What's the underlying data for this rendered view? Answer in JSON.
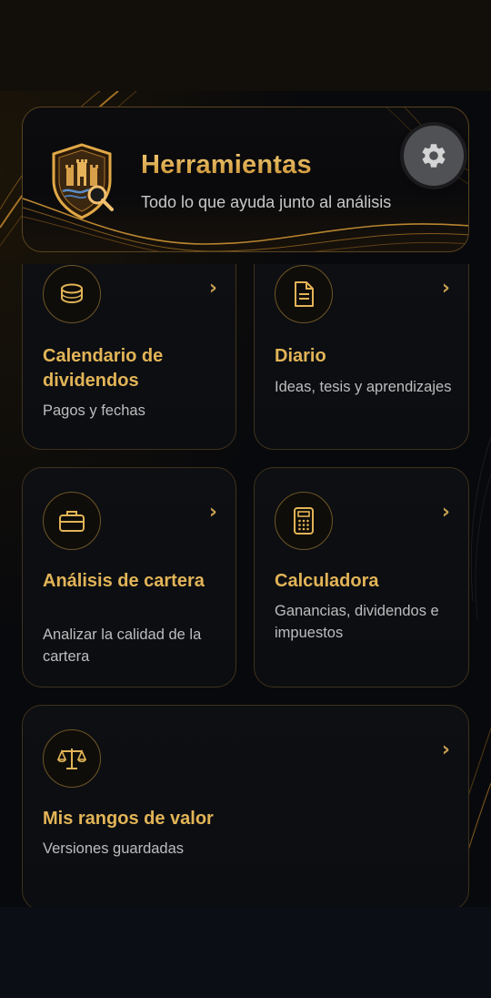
{
  "header": {
    "title": "Herramientas",
    "subtitle": "Todo lo que ayuda junto al análisis",
    "emblem_icon": "castle-shield-magnifier-icon",
    "settings_icon": "gear-icon"
  },
  "tools": [
    {
      "title": "Calendario de dividendos",
      "description": "Pagos y fechas",
      "icon": "coins-icon"
    },
    {
      "title": "Diario",
      "description": "Ideas, tesis y aprendizajes",
      "icon": "document-icon"
    },
    {
      "title": "Análisis de cartera",
      "description": "Analizar la calidad de la cartera",
      "icon": "briefcase-icon"
    },
    {
      "title": "Calculadora",
      "description": "Ganancias, dividendos e impuestos",
      "icon": "calculator-icon"
    },
    {
      "title": "Mis rangos de valor",
      "description": "Versiones guardadas",
      "icon": "scale-icon"
    }
  ],
  "chevron": "›",
  "colors": {
    "accent_gold": "#e2b457",
    "background": "#08090c",
    "card_border": "#3f321c",
    "settings_button": "#505154"
  }
}
